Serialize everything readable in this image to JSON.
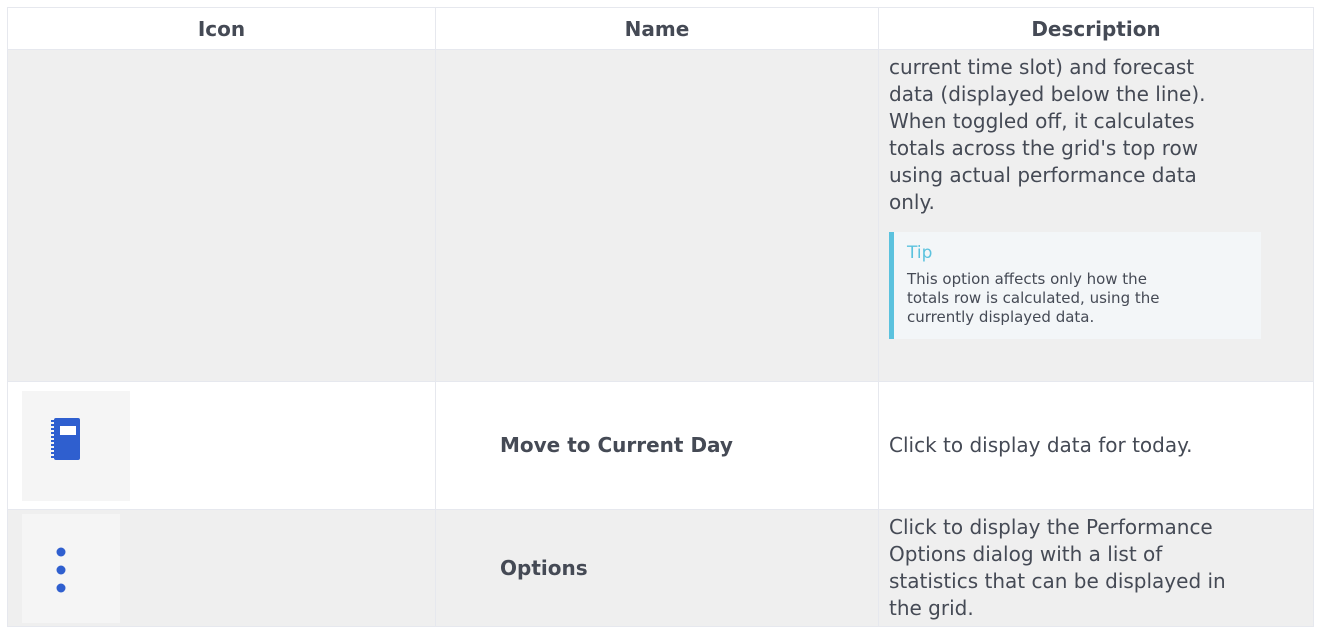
{
  "table": {
    "headers": {
      "icon": "Icon",
      "name": "Name",
      "description": "Description"
    },
    "rows": [
      {
        "name": "",
        "description_lines": [
          "current time slot) and forecast",
          "data (displayed below the line).",
          "When toggled off, it calculates",
          "totals across the grid's top row",
          "using actual performance data",
          "only."
        ],
        "tip": {
          "title": "Tip",
          "body_lines": [
            "This option affects only how the",
            "totals row is calculated, using the",
            "currently displayed data."
          ]
        }
      },
      {
        "icon": "notebook-icon",
        "name": "Move to Current Day",
        "description": "Click to display data for today."
      },
      {
        "icon": "vertical-ellipsis-icon",
        "name": "Options",
        "description_lines": [
          "Click to display the Performance",
          "Options dialog with a list of",
          "statistics that can be displayed in",
          "the grid."
        ]
      }
    ]
  },
  "colors": {
    "text": "#454a55",
    "tip_accent": "#5bc2de",
    "icon_blue": "#2f5fcf",
    "row_shade": "#efefef"
  }
}
